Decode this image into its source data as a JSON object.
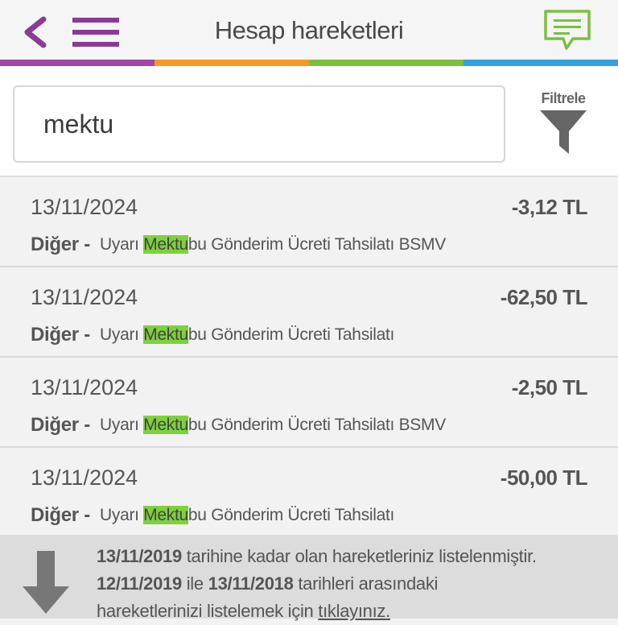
{
  "header": {
    "title": "Hesap hareketleri",
    "back_icon": "chevron-left-icon",
    "menu_icon": "hamburger-menu-icon",
    "chat_icon": "chat-bubble-icon",
    "stripe_colors": [
      "#a046a8",
      "#f39c1f",
      "#7ac13e",
      "#2ea3dd"
    ],
    "accent_purple": "#8b3a96",
    "chat_green": "#7ac13e"
  },
  "search": {
    "value": "mektu",
    "placeholder": ""
  },
  "filter": {
    "label": "Filtrele",
    "icon": "funnel-icon"
  },
  "transactions": [
    {
      "date": "13/11/2024",
      "amount": "-3,12 TL",
      "category": "Diğer -",
      "desc_before": "Uyarı ",
      "desc_match": "Mektu",
      "desc_after": "bu Gönderim Ücreti Tahsilatı BSMV"
    },
    {
      "date": "13/11/2024",
      "amount": "-62,50 TL",
      "category": "Diğer -",
      "desc_before": "Uyarı ",
      "desc_match": "Mektu",
      "desc_after": "bu Gönderim Ücreti Tahsilatı"
    },
    {
      "date": "13/11/2024",
      "amount": "-2,50 TL",
      "category": "Diğer -",
      "desc_before": "Uyarı ",
      "desc_match": "Mektu",
      "desc_after": "bu Gönderim Ücreti Tahsilatı BSMV"
    },
    {
      "date": "13/11/2024",
      "amount": "-50,00 TL",
      "category": "Diğer -",
      "desc_before": "Uyarı ",
      "desc_match": "Mektu",
      "desc_after": "bu Gönderim Ücreti Tahsilatı"
    }
  ],
  "highlight_color": "#7ed13c",
  "footer": {
    "icon": "arrow-down-icon",
    "date1": "13/11/2019",
    "text1": " tarihine kadar olan hareketleriniz listelenmiştir.",
    "date2": "12/11/2019",
    "text2": " ile ",
    "date3": "13/11/2018",
    "text3": " tarihleri arasındaki",
    "text4": "hareketlerinizi listelemek için ",
    "link": "tıklayınız."
  }
}
